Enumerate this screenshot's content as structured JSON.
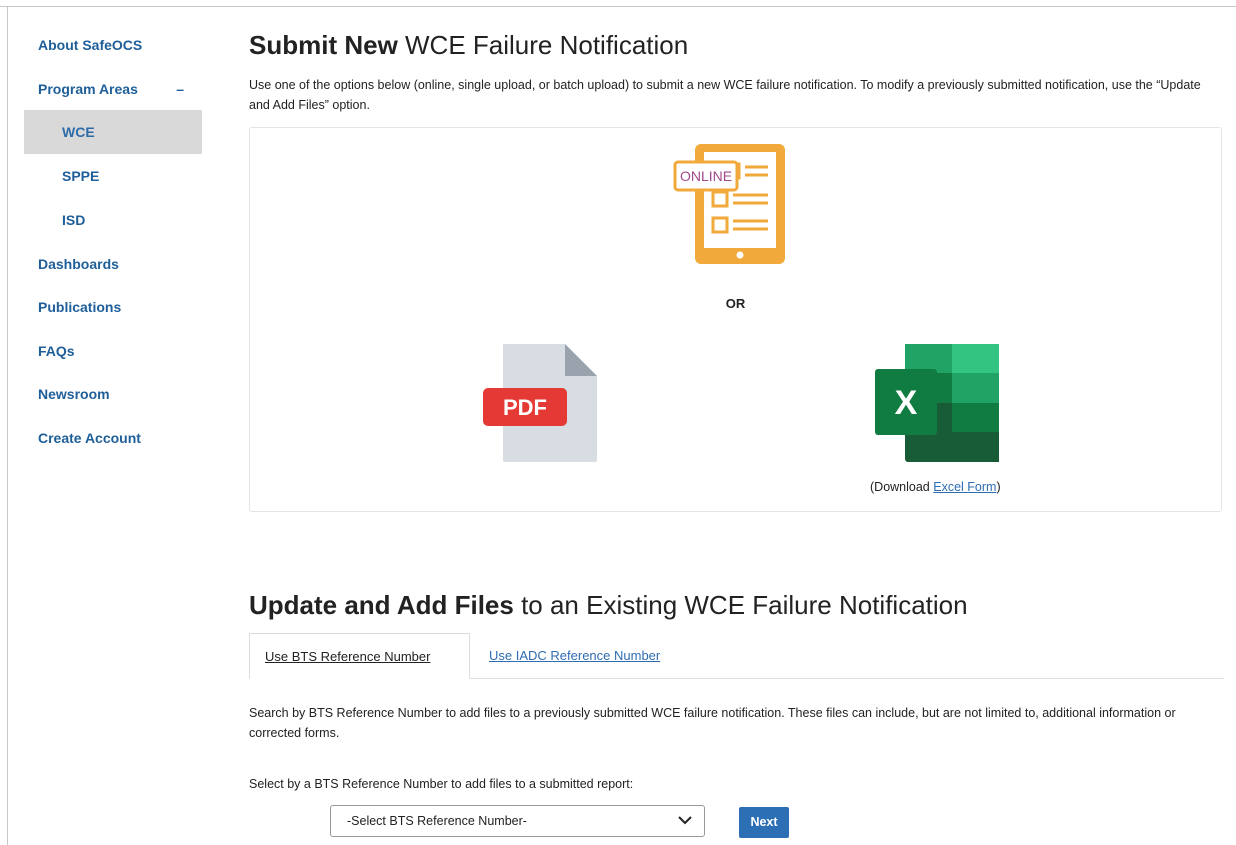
{
  "sidebar": {
    "items": [
      {
        "label": "About SafeOCS"
      },
      {
        "label": "Program Areas",
        "toggle": "–"
      },
      {
        "label": "WCE"
      },
      {
        "label": "SPPE"
      },
      {
        "label": "ISD"
      },
      {
        "label": "Dashboards"
      },
      {
        "label": "Publications"
      },
      {
        "label": "FAQs"
      },
      {
        "label": "Newsroom"
      },
      {
        "label": "Create Account"
      }
    ]
  },
  "submit": {
    "title_bold": "Submit New",
    "title_rest": " WCE Failure Notification",
    "intro": "Use one of the options below (online, single upload, or batch upload) to submit a new WCE failure notification. To modify a previously submitted notification, use the “Update and Add Files” option.",
    "online_badge": "ONLINE",
    "or_text": "OR",
    "pdf_label": "PDF",
    "excel_label": "X",
    "download_prefix": "(Download ",
    "download_link": "Excel Form",
    "download_suffix": ")"
  },
  "update": {
    "title_bold": "Update and Add Files",
    "title_rest": " to an Existing WCE Failure Notification",
    "tabs": [
      {
        "label": "Use BTS Reference Number",
        "active": true
      },
      {
        "label": "Use IADC Reference Number",
        "active": false
      }
    ],
    "description": "Search by BTS Reference Number to add files to a previously submitted WCE failure notification. These files can include, but are not limited to, additional information or corrected forms.",
    "select_label": "Select by a BTS Reference Number to add files to a submitted report:",
    "select_value": "-Select BTS Reference Number-",
    "next_label": "Next"
  },
  "colors": {
    "link": "#1f5f99",
    "online_orange": "#f2a93b",
    "online_purple": "#a04a8c",
    "pdf_red": "#e53935",
    "excel_green": "#21a366",
    "button_blue": "#2c6fb5"
  }
}
